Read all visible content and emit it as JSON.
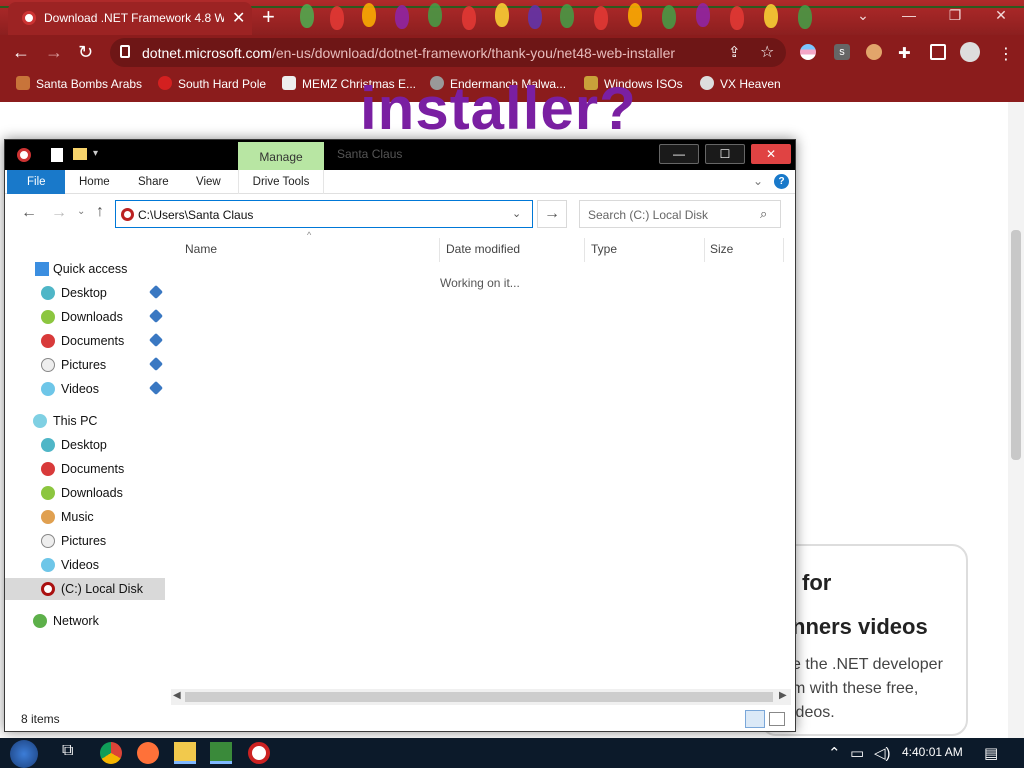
{
  "browser": {
    "tab_title": "Download .NET Framework 4.8 W",
    "url_domain": "dotnet.microsoft.com",
    "url_path": "/en-us/download/dotnet-framework/thank-you/net48-web-installer",
    "bookmarks": [
      "Santa Bombs Arabs",
      "South Hard Pole",
      "MEMZ Christmas E...",
      "Endermanch Malwa...",
      "Windows ISOs",
      "VX Heaven"
    ],
    "icons": [
      "back-icon",
      "forward-icon",
      "reload-icon",
      "lock-icon",
      "share-icon",
      "star-icon",
      "extensions-icon",
      "sidebar-icon",
      "profile-icon",
      "menu-icon"
    ]
  },
  "webpage": {
    "heading": "installer?",
    "card_line1": "for",
    "card_line2": "nners videos",
    "card_line3": "e the .NET developer",
    "card_line4": "m with these free,",
    "card_line5": "ideos."
  },
  "explorer": {
    "contextual_group": "Manage",
    "window_title": "Santa Claus",
    "ribbon_tabs": [
      "File",
      "Home",
      "Share",
      "View",
      "Drive Tools"
    ],
    "address": "C:\\Users\\Santa Claus",
    "search_placeholder": "Search (C:) Local Disk",
    "columns": [
      "Name",
      "Date modified",
      "Type",
      "Size"
    ],
    "working_text": "Working on it...",
    "quick_access": {
      "label": "Quick access",
      "items": [
        "Desktop",
        "Downloads",
        "Documents",
        "Pictures",
        "Videos"
      ]
    },
    "this_pc": {
      "label": "This PC",
      "items": [
        "Desktop",
        "Documents",
        "Downloads",
        "Music",
        "Pictures",
        "Videos",
        "(C:) Local Disk"
      ]
    },
    "network_label": "Network",
    "status_items": "8 items"
  },
  "taskbar": {
    "clock": "4:40:01 AM"
  }
}
